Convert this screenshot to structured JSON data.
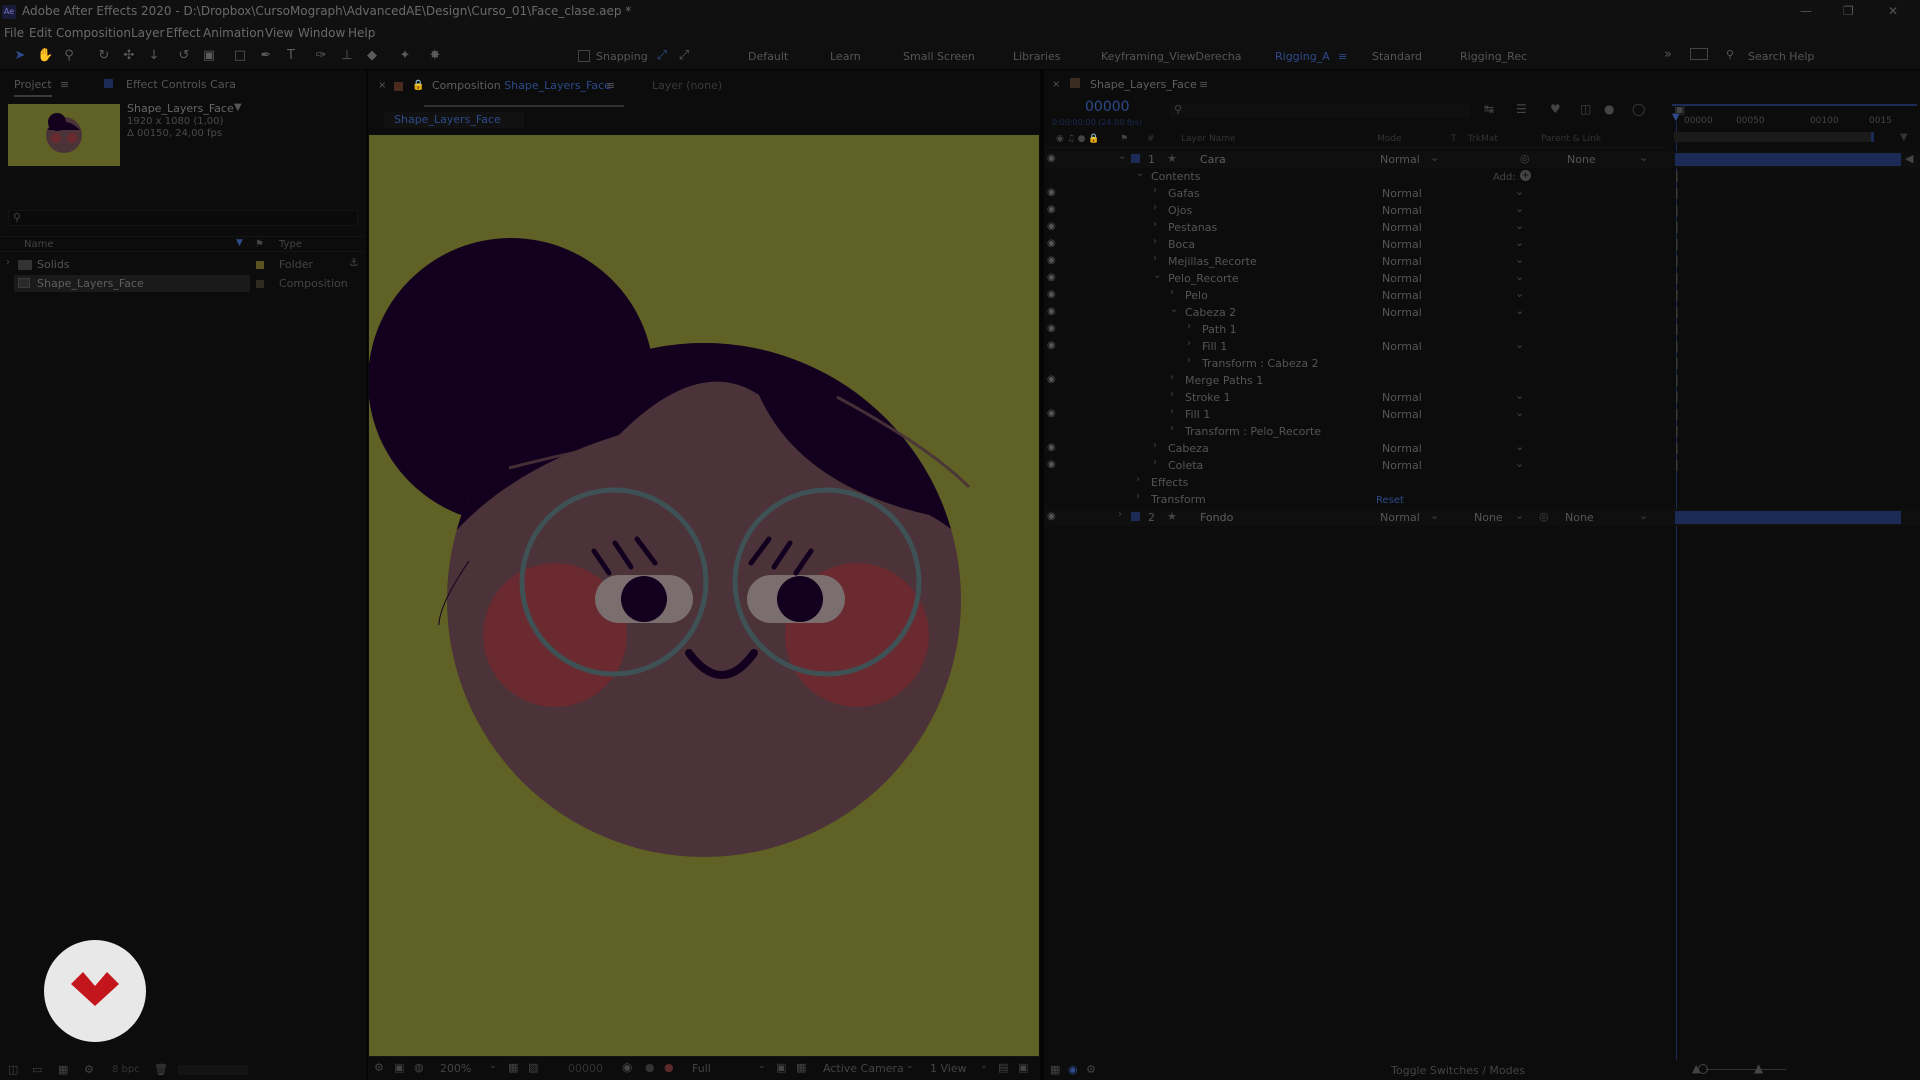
{
  "window": {
    "title": "Adobe After Effects 2020 - D:\\Dropbox\\CursoMograph\\AdvancedAE\\Design\\Curso_01\\Face_clase.aep *",
    "logo": "Ae"
  },
  "menu": [
    "File",
    "Edit",
    "Composition",
    "Layer",
    "Effect",
    "Animation",
    "View",
    "Window",
    "Help"
  ],
  "toolbar": {
    "snapping_label": "Snapping",
    "workspaces": [
      "Default",
      "Learn",
      "Small Screen",
      "Libraries",
      "Keyframing_ViewDerecha",
      "Rigging_A",
      "Standard",
      "Rigging_Rec"
    ],
    "active_workspace": "Rigging_A",
    "search_help": "Search Help"
  },
  "project_panel": {
    "tab_project": "Project",
    "tab_effect_controls": "Effect Controls Cara",
    "comp_name": "Shape_Layers_Face",
    "comp_info_1": "1920 x 1080 (1,00)",
    "comp_info_2": "Δ 00150, 24,00 fps",
    "search_placeholder": "",
    "col_name": "Name",
    "col_type": "Type",
    "items": [
      {
        "name": "Solids",
        "type": "Folder"
      },
      {
        "name": "Shape_Layers_Face",
        "type": "Composition"
      }
    ],
    "bpc": "8 bpc"
  },
  "composition_panel": {
    "tab_label": "Composition",
    "tab_comp_name": "Shape_Layers_Face",
    "layer_tab": "Layer  (none)",
    "breadcrumb": "Shape_Layers_Face",
    "zoom": "200%",
    "timecode": "00000",
    "resolution": "Full",
    "camera": "Active Camera",
    "views": "1 View"
  },
  "timeline_panel": {
    "tab_label": "Shape_Layers_Face",
    "timecode": "00000",
    "timecode_sub": "0:00:00:00 (24.00 fps)",
    "col_layer_name": "Layer Name",
    "col_mode": "Mode",
    "col_t": "T",
    "col_trkmat": "TrkMat",
    "col_parent": "Parent & Link",
    "ruler": [
      "00000",
      "00050",
      "00100",
      "0015"
    ],
    "add_label": "Add:",
    "reset_label": "Reset",
    "toggle_label": "Toggle Switches / Modes",
    "layers": [
      {
        "num": "1",
        "name": "Cara",
        "mode": "Normal",
        "parent": "None"
      },
      {
        "num": "2",
        "name": "Fondo",
        "mode": "Normal",
        "trkmat": "None",
        "parent": "None"
      }
    ],
    "props": [
      {
        "label": "Contents",
        "indent": 0,
        "mode": ""
      },
      {
        "label": "Gafas",
        "indent": 1,
        "mode": "Normal"
      },
      {
        "label": "Ojos",
        "indent": 1,
        "mode": "Normal"
      },
      {
        "label": "Pestanas",
        "indent": 1,
        "mode": "Normal"
      },
      {
        "label": "Boca",
        "indent": 1,
        "mode": "Normal"
      },
      {
        "label": "Mejillas_Recorte",
        "indent": 1,
        "mode": "Normal"
      },
      {
        "label": "Pelo_Recorte",
        "indent": 1,
        "mode": "Normal"
      },
      {
        "label": "Pelo",
        "indent": 2,
        "mode": "Normal"
      },
      {
        "label": "Cabeza 2",
        "indent": 2,
        "mode": "Normal"
      },
      {
        "label": "Path 1",
        "indent": 3,
        "mode": ""
      },
      {
        "label": "Fill 1",
        "indent": 3,
        "mode": "Normal"
      },
      {
        "label": "Transform : Cabeza 2",
        "indent": 3,
        "mode": ""
      },
      {
        "label": "Merge Paths 1",
        "indent": 2,
        "mode": ""
      },
      {
        "label": "Stroke 1",
        "indent": 2,
        "mode": "Normal"
      },
      {
        "label": "Fill 1",
        "indent": 2,
        "mode": "Normal"
      },
      {
        "label": "Transform : Pelo_Recorte",
        "indent": 2,
        "mode": ""
      },
      {
        "label": "Cabeza",
        "indent": 1,
        "mode": "Normal"
      },
      {
        "label": "Coleta",
        "indent": 1,
        "mode": "Normal"
      },
      {
        "label": "Effects",
        "indent": 0,
        "mode": ""
      },
      {
        "label": "Transform",
        "indent": 0,
        "mode": ""
      }
    ]
  },
  "colors": {
    "canvas_bg": "#5f6125",
    "hair": "#12001e",
    "face": "#4b3339",
    "cheeks": "#6a2a2f",
    "glasses": "#3e5256",
    "accent": "#2e4a8a"
  }
}
